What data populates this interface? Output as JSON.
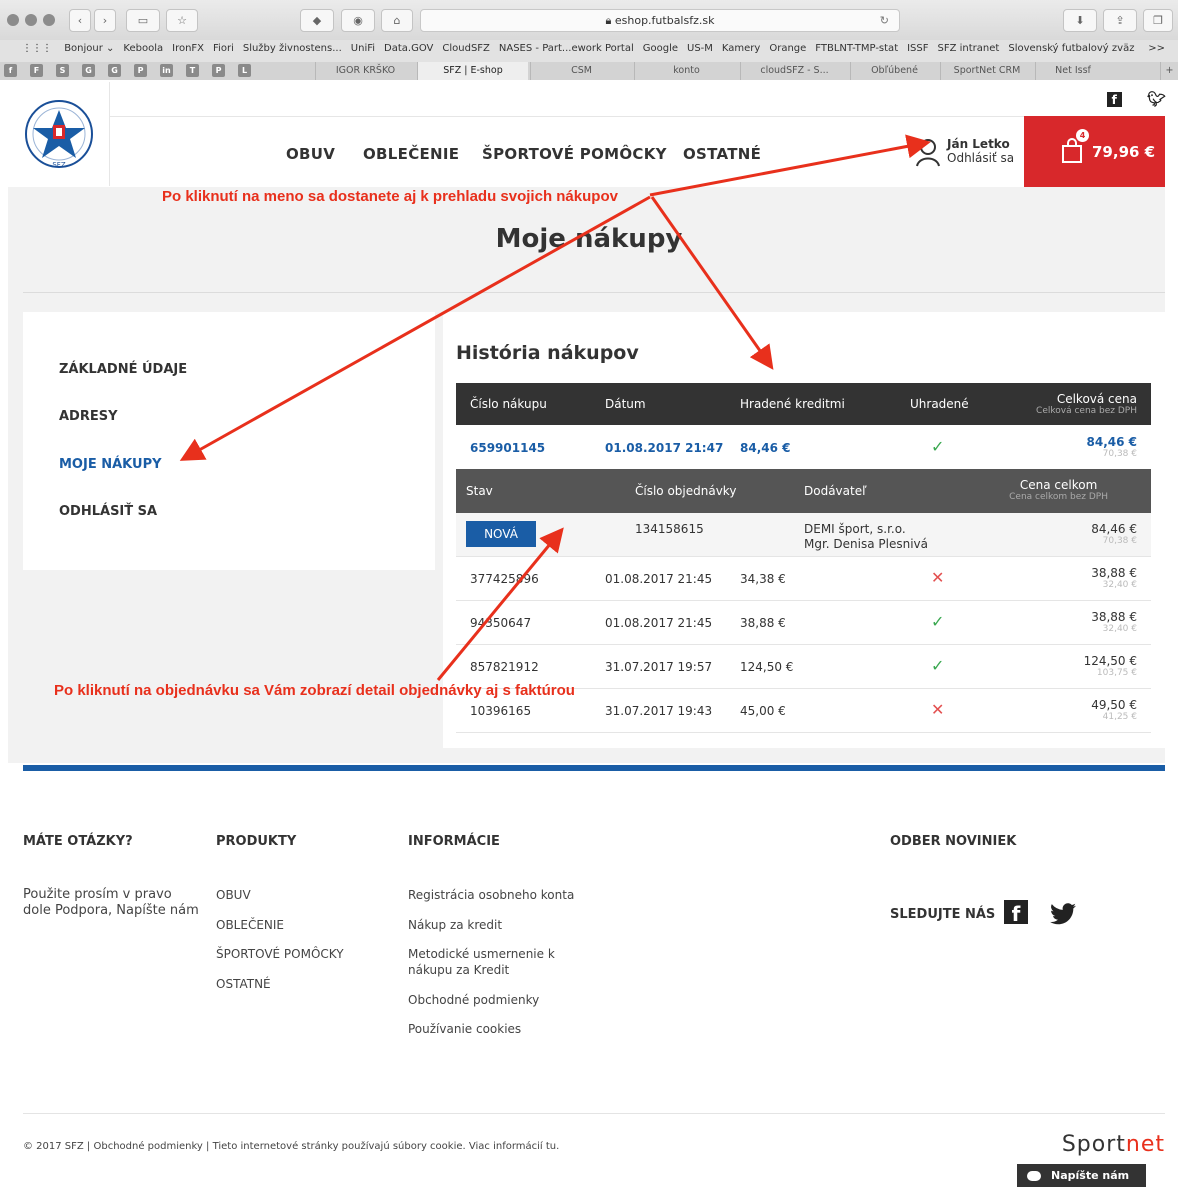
{
  "browser": {
    "url": "eshop.futbalsfz.sk",
    "bookmarks": [
      "Bonjour ⌄",
      "Keboola",
      "IronFX",
      "Fiori",
      "Služby živnostens...",
      "UniFi",
      "Data.GOV",
      "CloudSFZ",
      "NASES - Part...ework Portal",
      "Google",
      "US-M",
      "Kamery",
      "Orange",
      "FTBLNT-TMP-stat",
      "ISSF",
      "SFZ intranet",
      "Slovenský futbalový zväz"
    ],
    "tab_icons": [
      "f",
      "F",
      "S",
      "G",
      "G",
      "P",
      "in",
      "T",
      "P",
      "L"
    ],
    "tabs": [
      "IGOR KRŠKO",
      "SFZ | E-shop",
      "CSM",
      "konto",
      "cloudSFZ - S...",
      "Obľúbené",
      "SportNet CRM",
      "Net Issf"
    ],
    "active_tab": "SFZ | E-shop"
  },
  "header": {
    "nav": [
      "OBUV",
      "OBLEČENIE",
      "ŠPORTOVÉ POMÔCKY",
      "OSTATNÉ"
    ],
    "user_name": "Ján Letko",
    "logout": "Odhlásiť sa",
    "cart_total": "79,96 €",
    "cart_count": "4",
    "logo_text": "SFZ"
  },
  "page": {
    "title": "Moje nákupy",
    "sidebar": [
      "ZÁKLADNÉ ÚDAJE",
      "ADRESY",
      "MOJE NÁKUPY",
      "ODHLÁSIŤ SA"
    ],
    "history_title": "História nákupov",
    "columns": [
      "Číslo nákupu",
      "Dátum",
      "Hradené kreditmi",
      "Uhradené",
      "Celková cena",
      "Celková cena bez DPH"
    ],
    "expanded": {
      "number": "659901145",
      "date": "01.08.2017 21:47",
      "credit": "84,46 €",
      "paid": true,
      "total": "84,46 €",
      "net": "70,38 €"
    },
    "sub_columns": [
      "Stav",
      "Číslo objednávky",
      "Dodávateľ",
      "Cena celkom",
      "Cena celkom bez DPH"
    ],
    "sub_row": {
      "status": "NOVÁ",
      "order": "134158615",
      "supplier1": "DEMI šport, s.r.o.",
      "supplier2": "Mgr. Denisa Plesnivá",
      "total": "84,46 €",
      "net": "70,38 €"
    },
    "rows": [
      {
        "number": "377425896",
        "date": "01.08.2017 21:45",
        "credit": "34,38 €",
        "paid": false,
        "total": "38,88 €",
        "net": "32,40 €"
      },
      {
        "number": "94350647",
        "date": "01.08.2017 21:45",
        "credit": "38,88 €",
        "paid": true,
        "total": "38,88 €",
        "net": "32,40 €"
      },
      {
        "number": "857821912",
        "date": "31.07.2017 19:57",
        "credit": "124,50 €",
        "paid": true,
        "total": "124,50 €",
        "net": "103,75 €"
      },
      {
        "number": "10396165",
        "date": "31.07.2017 19:43",
        "credit": "45,00 €",
        "paid": false,
        "total": "49,50 €",
        "net": "41,25 €"
      }
    ]
  },
  "annotations": {
    "top": "Po kliknutí na meno sa dostanete aj k prehladu svojich nákupov",
    "bottom": "Po kliknutí na objednávku sa Vám zobrazí detail objednávky aj s faktúrou"
  },
  "footer": {
    "col1_title": "MÁTE OTÁZKY?",
    "col1_text1": "Použite prosím v pravo",
    "col1_text2": "dole Podpora, Napíšte nám",
    "col2_title": "PRODUKTY",
    "col2_items": [
      "OBUV",
      "OBLEČENIE",
      "ŠPORTOVÉ POMÔCKY",
      "OSTATNÉ"
    ],
    "col3_title": "INFORMÁCIE",
    "col3_items": [
      "Registrácia osobneho konta",
      "Nákup za kredit",
      "Metodické usmernenie k",
      "nákupu za Kredit",
      "Obchodné podmienky",
      "Používanie cookies"
    ],
    "col4_title": "ODBER NOVINIEK",
    "follow": "SLEDUJTE NÁS",
    "copyright": "© 2017 SFZ | Obchodné podmienky | Tieto internetové stránky používajú súbory cookie. Viac informácií tu.",
    "brand1": "Sport",
    "brand2": "net",
    "chat": "Napíšte nám"
  },
  "colors": {
    "accent": "#1a5da6",
    "cart": "#d8282b",
    "annotation": "#e8301c"
  }
}
